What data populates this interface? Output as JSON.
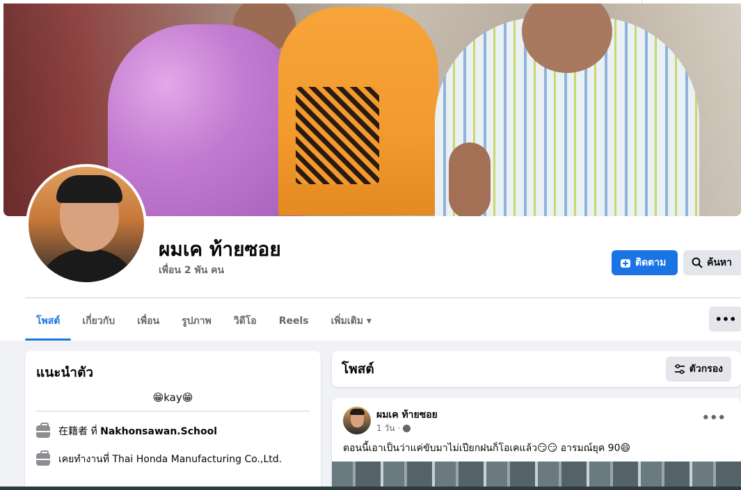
{
  "profile": {
    "name": "ผมเค ท้ายซอย",
    "friends": "เพื่อน 2 พัน คน",
    "follow_label": "ติดตาม",
    "search_label": "ค้นหา"
  },
  "tabs": [
    {
      "label": "โพสต์"
    },
    {
      "label": "เกี่ยวกับ"
    },
    {
      "label": "เพื่อน"
    },
    {
      "label": "รูปภาพ"
    },
    {
      "label": "วิดีโอ"
    },
    {
      "label": "Reels"
    },
    {
      "label": "เพิ่มเติม ▾"
    }
  ],
  "more_label": "•••",
  "intro": {
    "title": "แนะนำตัว",
    "bio": "😁kay😁",
    "rows": [
      {
        "prefix": "在籍者 ที่ ",
        "value": "Nakhonsawan.School"
      },
      {
        "prefix": "เคยทำงานที่ ",
        "value": "Thai Honda Manufacturing Co.,Ltd."
      }
    ]
  },
  "posts": {
    "title": "โพสต์",
    "filter_label": "ตัวกรอง",
    "item": {
      "author": "ผมเค ท้ายซอย",
      "time": "1 วัน ·",
      "text": "ตอนนี้เอาเป็นว่าแค่ขับมาไม่เปียกฝนก็โอเคแล้ว😏😏 อารมณ์ยุค 90😄",
      "more": "•••"
    }
  },
  "colors": {
    "accent": "#1b74e4",
    "background": "#f0f2f5",
    "text_secondary": "#65676b"
  },
  "icons": [
    "follow-plus-icon",
    "search-icon",
    "filter-icon",
    "briefcase-icon",
    "globe-icon",
    "more-icon"
  ]
}
